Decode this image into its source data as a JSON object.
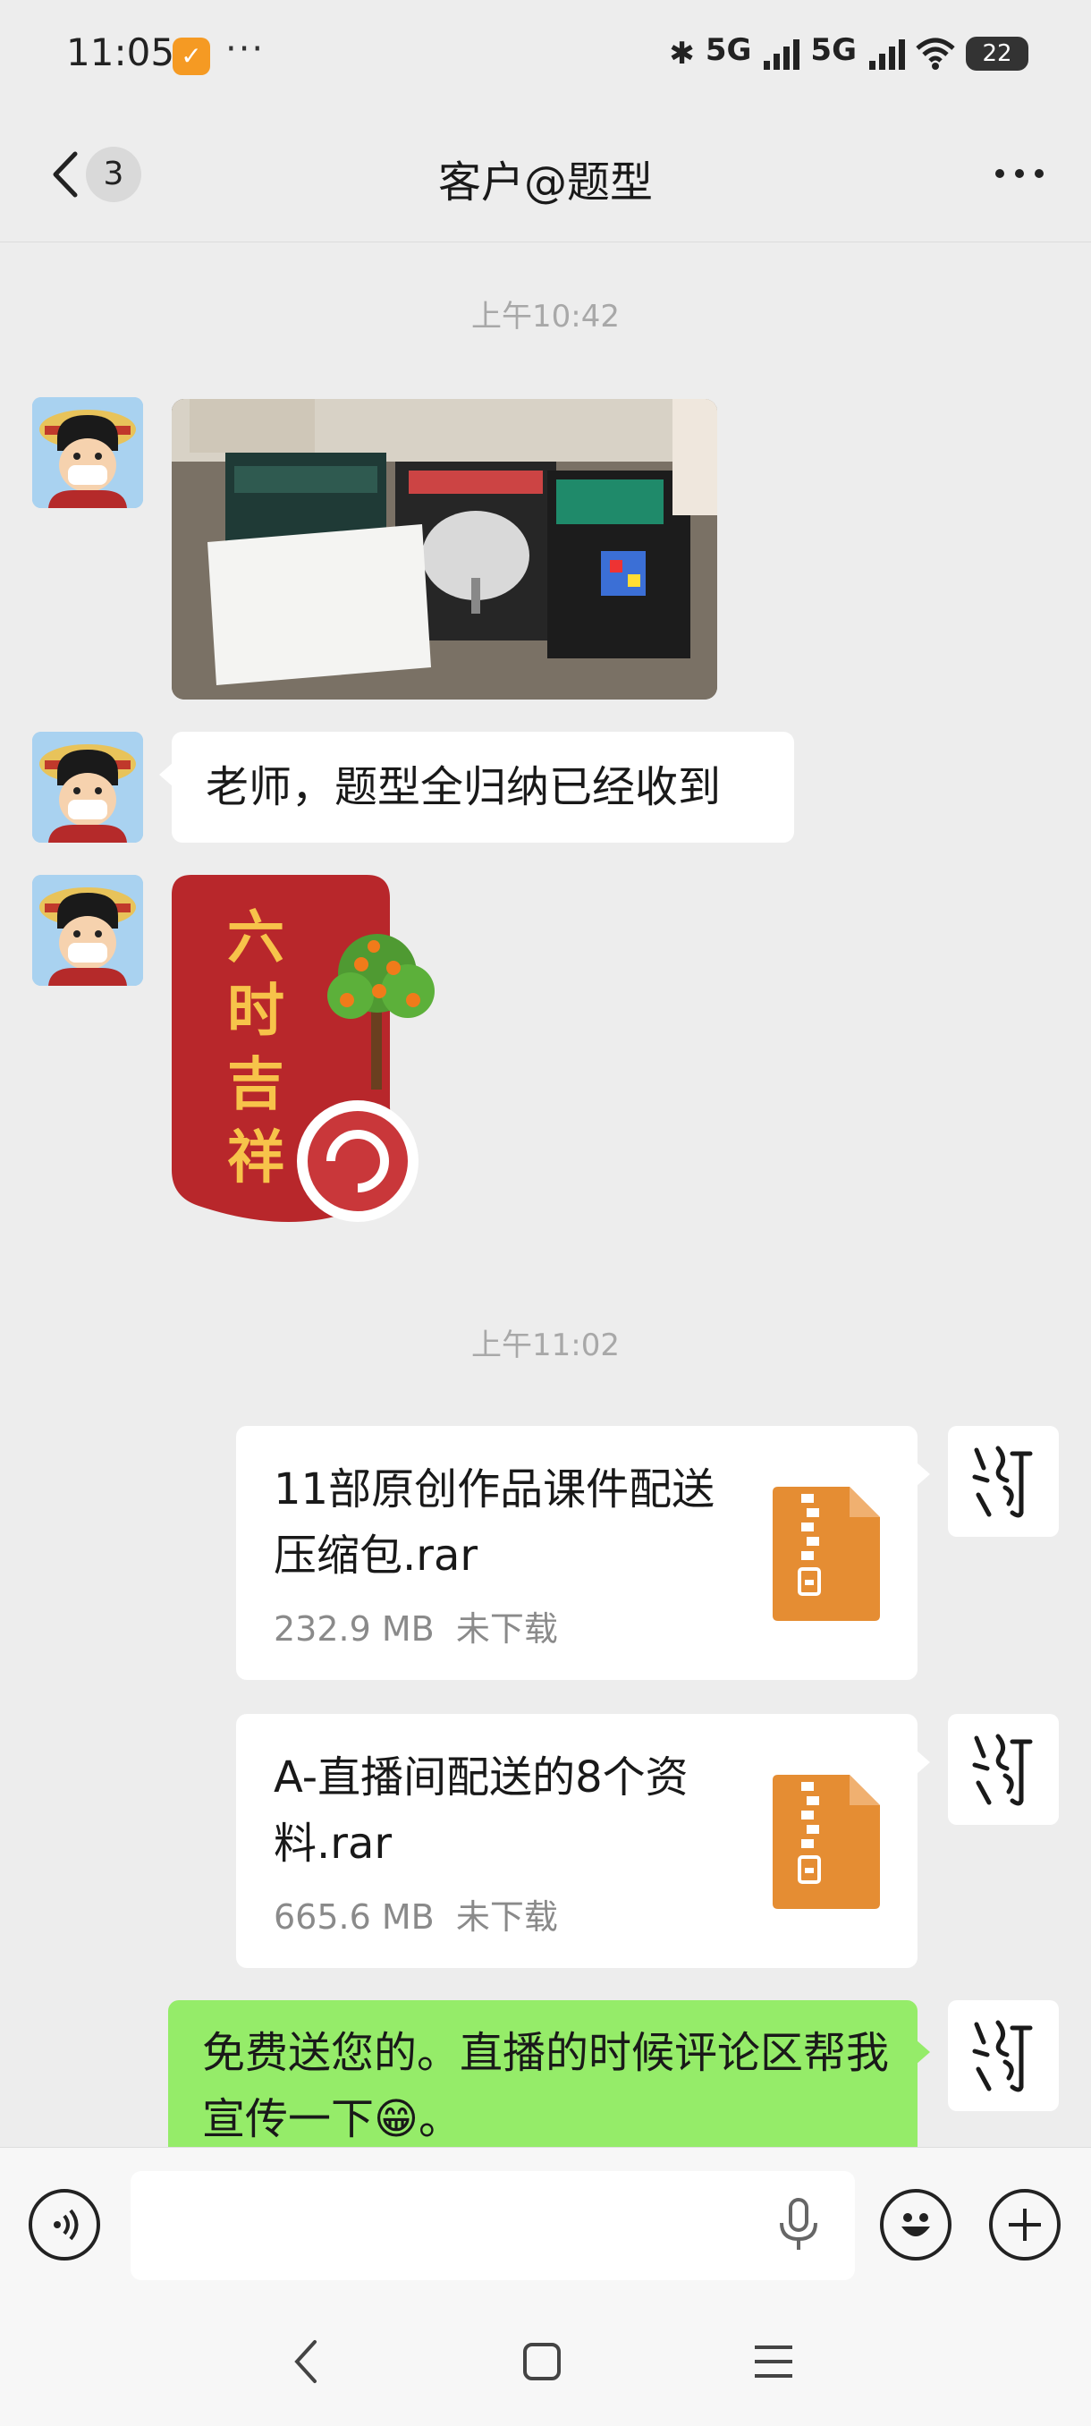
{
  "status_bar": {
    "time": "11:05",
    "more_indicator": "···",
    "signal1_label": "5G",
    "signal2_label": "5G",
    "battery_level": "22"
  },
  "header": {
    "unread_count": "3",
    "title": "客户@题型",
    "more_icon": "···"
  },
  "messages": {
    "timestamp_1": "上午10:42",
    "text_1": "老师，题型全归纳已经收到",
    "sticker_text": "六时吉祥",
    "timestamp_2": "上午11:02",
    "file_1": {
      "name": "11部原创作品课件配送压缩包.rar",
      "size": "232.9 MB",
      "status": "未下载"
    },
    "file_2": {
      "name": "A-直播间配送的8个资料.rar",
      "size": "665.6 MB",
      "status": "未下载"
    },
    "text_2": "免费送您的。直播的时候评论区帮我宣传一下😁。"
  },
  "colors": {
    "chat_bg": "#ededed",
    "sent_bubble": "#95ec69",
    "file_icon": "#e58d33",
    "sticker_red": "#b8272b"
  },
  "input_bar": {
    "value": "",
    "icons": [
      "voice-icon",
      "mic-icon",
      "emoji-icon",
      "plus-icon"
    ]
  },
  "system_nav": {
    "icons": [
      "back-icon",
      "home-icon",
      "menu-icon"
    ]
  }
}
